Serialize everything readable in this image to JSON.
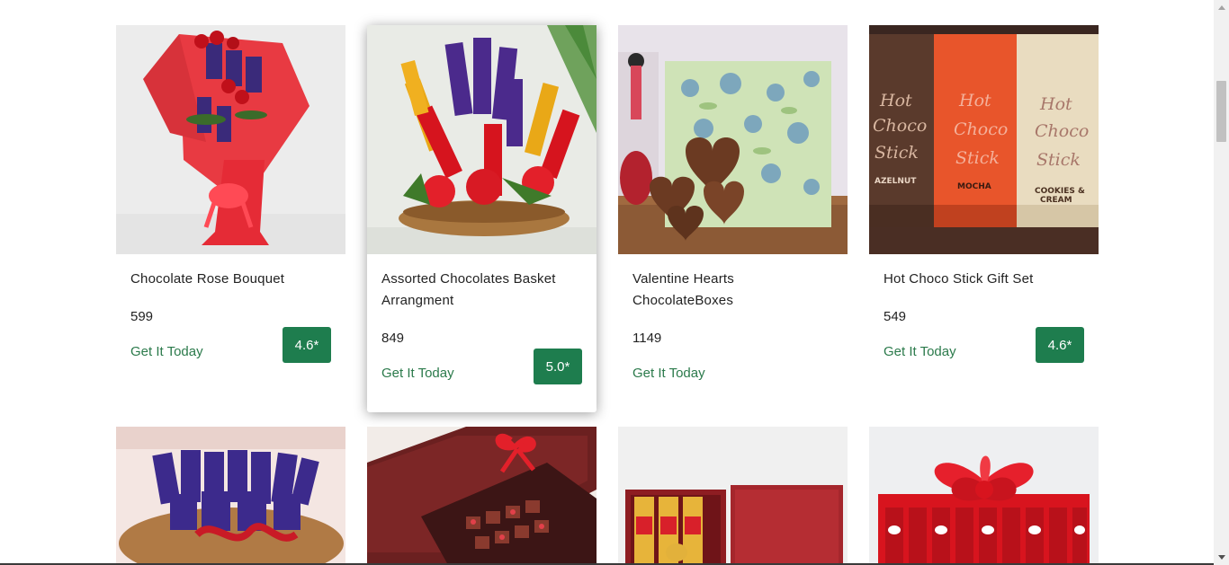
{
  "products_row1": [
    {
      "title": "Chocolate Rose Bouquet",
      "price": "599",
      "delivery": "Get It Today",
      "rating": "4.6*",
      "image": "chocolate-rose-bouquet-image"
    },
    {
      "title": "Assorted Chocolates Basket Arrangment",
      "price": "849",
      "delivery": "Get It Today",
      "rating": "5.0*",
      "image": "chocolate-basket-image"
    },
    {
      "title": "Valentine Hearts ChocolateBoxes",
      "price": "1149",
      "delivery": "Get It Today",
      "rating": "",
      "image": "valentine-hearts-image"
    },
    {
      "title": "Hot Choco Stick Gift Set",
      "price": "549",
      "delivery": "Get It Today",
      "rating": "4.6*",
      "image": "hot-choco-stick-image"
    }
  ],
  "choco_boxes": [
    {
      "line1": "Hot",
      "line2": "Choco",
      "line3": "Stick",
      "flavor": "AZELNUT"
    },
    {
      "line1": "Hot",
      "line2": "Choco",
      "line3": "Stick",
      "flavor": "MOCHA"
    },
    {
      "line1": "Hot",
      "line2": "Choco",
      "line3": "Stick",
      "flavor": "COOKIES &",
      "flavor2": "CREAM"
    }
  ],
  "colors": {
    "rating_bg": "#1e7d4e",
    "delivery_text": "#2b7a4b"
  }
}
